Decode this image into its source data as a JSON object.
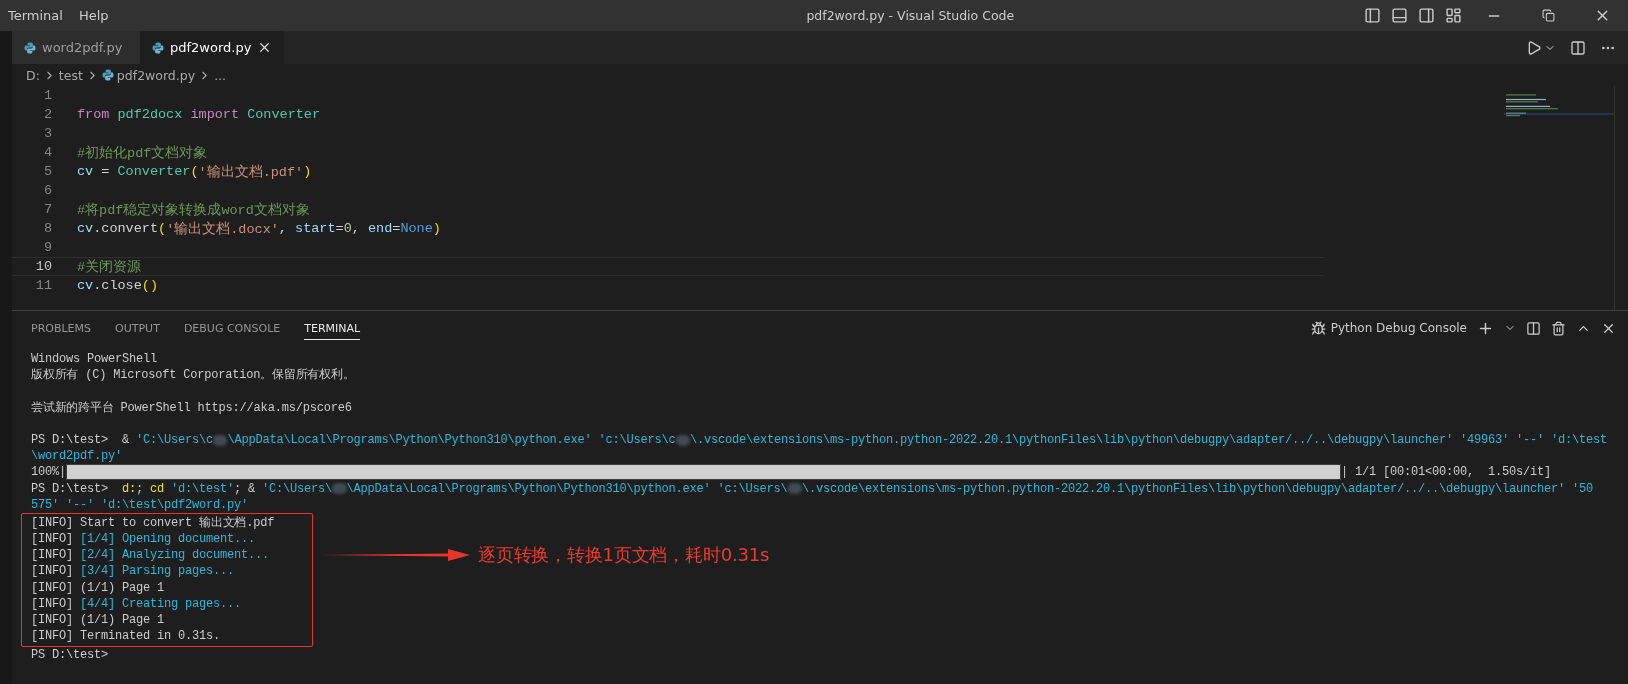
{
  "menu": [
    "Terminal",
    "Help"
  ],
  "window": {
    "title": "pdf2word.py - Visual Studio Code"
  },
  "tabs": [
    {
      "label": "word2pdf.py",
      "selected": false
    },
    {
      "label": "pdf2word.py",
      "selected": true
    }
  ],
  "breadcrumb": [
    {
      "label": "D:",
      "file": false
    },
    {
      "label": "test",
      "file": false
    },
    {
      "label": "pdf2word.py",
      "file": true
    },
    {
      "label": "...",
      "file": false
    }
  ],
  "code": [
    {
      "number": "1",
      "current": false
    },
    {
      "number": "2",
      "current": false,
      "tokens": [
        {
          "text": "from",
          "kind": "keyword"
        },
        {
          "text": " pdf2docx",
          "kind": "class"
        },
        {
          "text": " import",
          "kind": "keyword"
        },
        {
          "text": " Converter",
          "kind": "class"
        }
      ]
    },
    {
      "number": "3",
      "current": false
    },
    {
      "number": "4",
      "current": false,
      "tokens": [
        {
          "text": "#初始化pdf文档对象",
          "kind": "comment"
        }
      ]
    },
    {
      "number": "5",
      "current": false,
      "tokens": [
        {
          "text": "cv",
          "kind": "variable"
        },
        {
          "text": " = ",
          "kind": "plain"
        },
        {
          "text": "Converter",
          "kind": "class"
        },
        {
          "text": "(",
          "kind": "bracket"
        },
        {
          "text": "'输出文档.pdf'",
          "kind": "string"
        },
        {
          "text": ")",
          "kind": "bracket"
        }
      ]
    },
    {
      "number": "6",
      "current": false
    },
    {
      "number": "7",
      "current": false,
      "tokens": [
        {
          "text": "#将pdf稳定对象转换成word文档对象",
          "kind": "comment"
        }
      ]
    },
    {
      "number": "8",
      "current": false,
      "tokens": [
        {
          "text": "cv",
          "kind": "variable"
        },
        {
          "text": ".convert",
          "kind": "plain"
        },
        {
          "text": "(",
          "kind": "bracket"
        },
        {
          "text": "'输出文档.docx'",
          "kind": "string"
        },
        {
          "text": ", ",
          "kind": "plain"
        },
        {
          "text": "start",
          "kind": "variable"
        },
        {
          "text": "=",
          "kind": "plain"
        },
        {
          "text": "0",
          "kind": "number"
        },
        {
          "text": ", ",
          "kind": "plain"
        },
        {
          "text": "end",
          "kind": "variable"
        },
        {
          "text": "=",
          "kind": "plain"
        },
        {
          "text": "None",
          "kind": "constant"
        },
        {
          "text": ")",
          "kind": "bracket"
        }
      ]
    },
    {
      "number": "9",
      "current": false
    },
    {
      "number": "10",
      "current": true,
      "tokens": [
        {
          "text": "#关闭资源",
          "kind": "comment"
        }
      ]
    },
    {
      "number": "11",
      "current": false,
      "tokens": [
        {
          "text": "cv",
          "kind": "variable"
        },
        {
          "text": ".close",
          "kind": "plain"
        },
        {
          "text": "()",
          "kind": "bracket"
        }
      ]
    }
  ],
  "panel_tabs": [
    {
      "label": "PROBLEMS",
      "selected": false
    },
    {
      "label": "OUTPUT",
      "selected": false
    },
    {
      "label": "DEBUG CONSOLE",
      "selected": false
    },
    {
      "label": "TERMINAL",
      "selected": true
    }
  ],
  "terminal_profile": "Python Debug Console",
  "terminal": {
    "lines": [
      {
        "kind": "text",
        "segments": [
          {
            "text": "Windows PowerShell",
            "kind": "plain"
          }
        ]
      },
      {
        "kind": "text",
        "segments": [
          {
            "text": "版权所有 (C) Microsoft Corporation。保留所有权利。",
            "kind": "plain"
          }
        ]
      },
      {
        "kind": "blank"
      },
      {
        "kind": "text",
        "segments": [
          {
            "text": "尝试新的跨平台 PowerShell https://aka.ms/pscore6",
            "kind": "plain"
          }
        ]
      },
      {
        "kind": "blank"
      },
      {
        "kind": "text",
        "segments": [
          {
            "text": "PS D:\\test>  & ",
            "kind": "plain"
          },
          {
            "text": "'C:\\Users\\c",
            "kind": "cyan"
          },
          {
            "kind": "redacted"
          },
          {
            "text": "\\AppData\\Local\\Programs\\Python\\Python310\\python.exe' 'c:\\Users\\c",
            "kind": "cyan"
          },
          {
            "kind": "redacted"
          },
          {
            "text": "\\.vscode\\extensions\\ms-python.python-2022.20.1\\pythonFiles\\lib\\python\\debugpy\\adapter/../..\\debugpy\\launcher' '49963' '--' 'd:\\test",
            "kind": "cyan"
          }
        ]
      },
      {
        "kind": "text",
        "segments": [
          {
            "text": "\\word2pdf.py'",
            "kind": "cyan"
          }
        ]
      },
      {
        "kind": "progress",
        "prefix": "100%|",
        "level": 1,
        "suffix": "| 1/1 [00:01<00:00,  1.50s/it]"
      },
      {
        "kind": "text",
        "segments": [
          {
            "text": "PS D:\\test>  ",
            "kind": "plain"
          },
          {
            "text": "d:",
            "kind": "yellow"
          },
          {
            "text": "; ",
            "kind": "plain"
          },
          {
            "text": "cd",
            "kind": "yellow"
          },
          {
            "text": " 'd:\\test'",
            "kind": "cyan"
          },
          {
            "text": "; & ",
            "kind": "plain"
          },
          {
            "text": "'C:\\Users\\",
            "kind": "cyan"
          },
          {
            "kind": "redacted"
          },
          {
            "text": "\\AppData\\Local\\Programs\\Python\\Python310\\python.exe' 'c:\\Users\\",
            "kind": "cyan"
          },
          {
            "kind": "redacted"
          },
          {
            "text": "\\.vscode\\extensions\\ms-python.python-2022.20.1\\pythonFiles\\lib\\python\\debugpy\\adapter/../..\\debugpy\\launcher' '50",
            "kind": "cyan"
          }
        ]
      },
      {
        "kind": "text",
        "segments": [
          {
            "text": "575' '--' 'd:\\test\\pdf2word.py'",
            "kind": "cyan"
          }
        ]
      }
    ],
    "callout": {
      "lines": [
        {
          "kind": "text",
          "segments": [
            {
              "text": "[INFO] Start to convert 输出文档.pdf",
              "kind": "plain"
            }
          ]
        },
        {
          "kind": "text",
          "segments": [
            {
              "text": "[INFO] ",
              "kind": "plain"
            },
            {
              "text": "[1/4] Opening document...",
              "kind": "cyan"
            }
          ]
        },
        {
          "kind": "text",
          "segments": [
            {
              "text": "[INFO] ",
              "kind": "plain"
            },
            {
              "text": "[2/4] Analyzing document...",
              "kind": "cyan"
            }
          ]
        },
        {
          "kind": "text",
          "segments": [
            {
              "text": "[INFO] ",
              "kind": "plain"
            },
            {
              "text": "[3/4] Parsing pages...",
              "kind": "cyan"
            }
          ]
        },
        {
          "kind": "text",
          "segments": [
            {
              "text": "[INFO] (1/1) Page 1",
              "kind": "plain"
            }
          ]
        },
        {
          "kind": "text",
          "segments": [
            {
              "text": "[INFO] ",
              "kind": "plain"
            },
            {
              "text": "[4/4] Creating pages...",
              "kind": "cyan"
            }
          ]
        },
        {
          "kind": "text",
          "segments": [
            {
              "text": "[INFO] (1/1) Page 1",
              "kind": "plain"
            }
          ]
        },
        {
          "kind": "text",
          "segments": [
            {
              "text": "[INFO] Terminated in 0.31s.",
              "kind": "plain"
            }
          ]
        }
      ],
      "note": "逐页转换，转换1页文档，耗时0.31s"
    },
    "after": [
      {
        "kind": "text",
        "segments": [
          {
            "text": "PS D:\\test>",
            "kind": "plain"
          }
        ]
      }
    ]
  }
}
